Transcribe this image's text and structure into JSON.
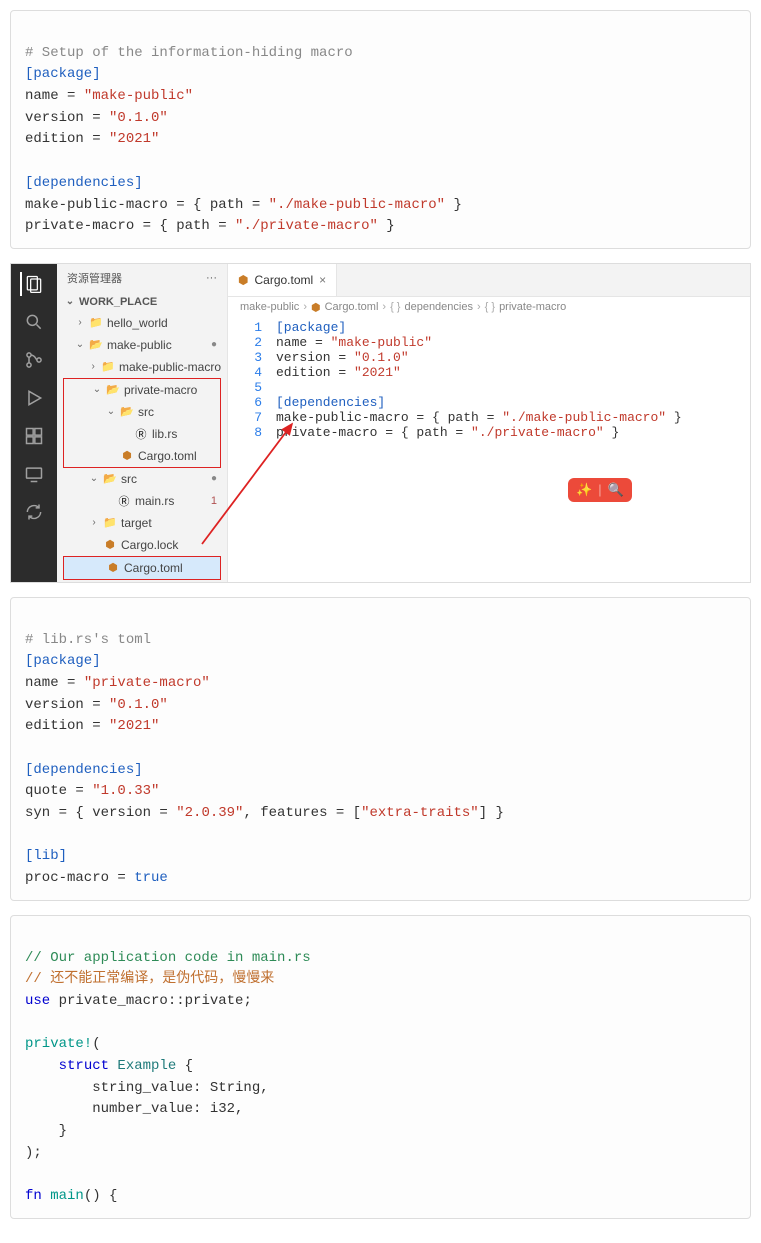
{
  "block1": {
    "comment": "# Setup of the information-hiding macro",
    "s_package": "[package]",
    "name_k": "name = ",
    "name_v": "\"make-public\"",
    "ver_k": "version = ",
    "ver_v": "\"0.1.0\"",
    "ed_k": "edition = ",
    "ed_v": "\"2021\"",
    "s_deps": "[dependencies]",
    "dep1_k": "make-public-macro = { path = ",
    "dep1_v": "\"./make-public-macro\"",
    "dep1_e": " }",
    "dep2_k": "private-macro = { path = ",
    "dep2_v": "\"./private-macro\"",
    "dep2_e": " }"
  },
  "vscode": {
    "explorer_title": "资源管理器",
    "workplace": "WORK_PLACE",
    "tree": {
      "hello_world": "hello_world",
      "make_public": "make-public",
      "make_public_macro": "make-public-macro",
      "private_macro": "private-macro",
      "src1": "src",
      "lib_rs": "lib.rs",
      "cargo1": "Cargo.toml",
      "src2": "src",
      "main_rs": "main.rs",
      "target": "target",
      "cargo_lock": "Cargo.lock",
      "cargo2": "Cargo.toml",
      "num1": "1"
    },
    "tab": "Cargo.toml",
    "breadcrumb": {
      "p1": "make-public",
      "p2": "Cargo.toml",
      "p3": "dependencies",
      "p4": "private-macro"
    },
    "code": {
      "l1": "[package]",
      "l2a": "name = ",
      "l2b": "\"make-public\"",
      "l3a": "version = ",
      "l3b": "\"0.1.0\"",
      "l4a": "edition = ",
      "l4b": "\"2021\"",
      "l6": "[dependencies]",
      "l7a": "make-public-macro = { path = ",
      "l7b": "\"./make-public-macro\"",
      "l7c": " }",
      "l8a": "private-macro = { path = ",
      "l8b": "\"./private-macro\"",
      "l8c": " }"
    }
  },
  "block3": {
    "comment": "# lib.rs's toml",
    "s_package": "[package]",
    "name_k": "name = ",
    "name_v": "\"private-macro\"",
    "ver_k": "version = ",
    "ver_v": "\"0.1.0\"",
    "ed_k": "edition = ",
    "ed_v": "\"2021\"",
    "s_deps": "[dependencies]",
    "quote_k": "quote = ",
    "quote_v": "\"1.0.33\"",
    "syn_k": "syn = { version = ",
    "syn_v": "\"2.0.39\"",
    "syn_m": ", features = [",
    "syn_f": "\"extra-traits\"",
    "syn_e": "] }",
    "s_lib": "[lib]",
    "proc_k": "proc-macro = ",
    "proc_v": "true"
  },
  "block4": {
    "c1": "// Our application code in main.rs",
    "c2": "// 还不能正常编译，是伪代码，慢慢来",
    "use_k": "use",
    "use_p": " private_macro::private;",
    "private": "private!",
    "paren_o": "(",
    "struct_k": "struct",
    "struct_n": " Example",
    "brace_o": " {",
    "f1": "        string_value: String,",
    "f2": "        number_value: i32,",
    "brace_c": "    }",
    "paren_c": ");",
    "fn_k": "fn",
    "main_n": " main",
    "main_p": "() {"
  }
}
